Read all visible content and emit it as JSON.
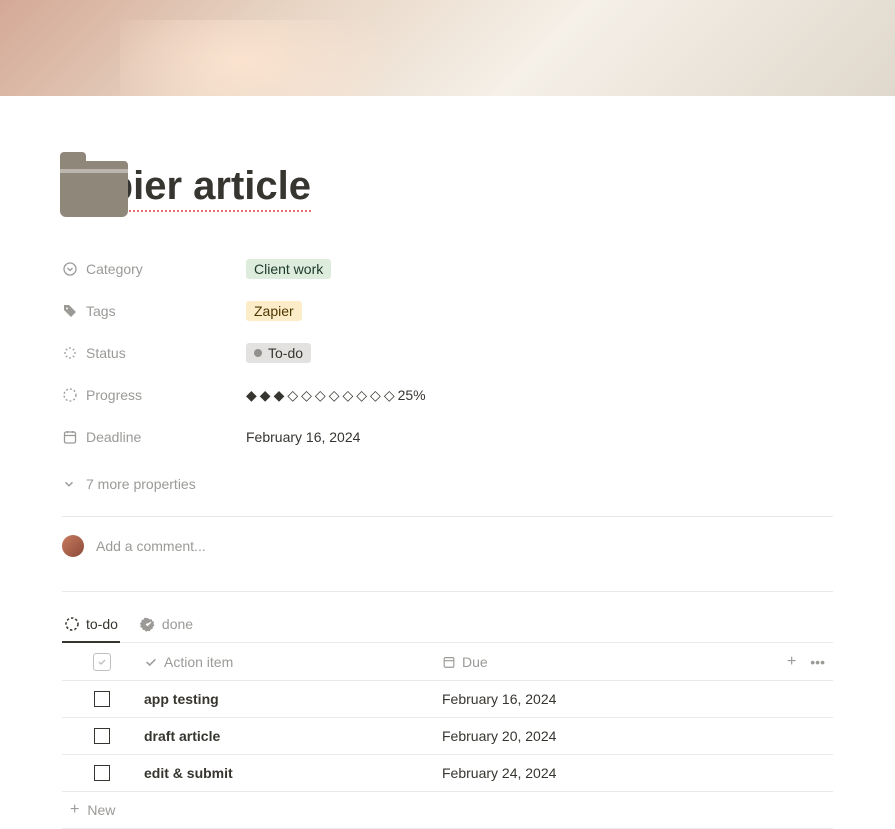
{
  "page": {
    "title": "Zapier article"
  },
  "properties": {
    "category": {
      "label": "Category",
      "value": "Client work"
    },
    "tags": {
      "label": "Tags",
      "value": "Zapier"
    },
    "status": {
      "label": "Status",
      "value": "To-do"
    },
    "progress": {
      "label": "Progress",
      "filled": 3,
      "total": 11,
      "percent_text": "25%"
    },
    "deadline": {
      "label": "Deadline",
      "value": "February 16, 2024"
    },
    "more": "7 more properties"
  },
  "comment": {
    "placeholder": "Add a comment..."
  },
  "tabs": {
    "todo": "to-do",
    "done": "done"
  },
  "table": {
    "headers": {
      "action": "Action item",
      "due": "Due"
    },
    "rows": [
      {
        "action": "app testing",
        "due": "February 16, 2024"
      },
      {
        "action": "draft article",
        "due": "February 20, 2024"
      },
      {
        "action": "edit & submit",
        "due": "February 24, 2024"
      }
    ],
    "new_label": "New"
  }
}
